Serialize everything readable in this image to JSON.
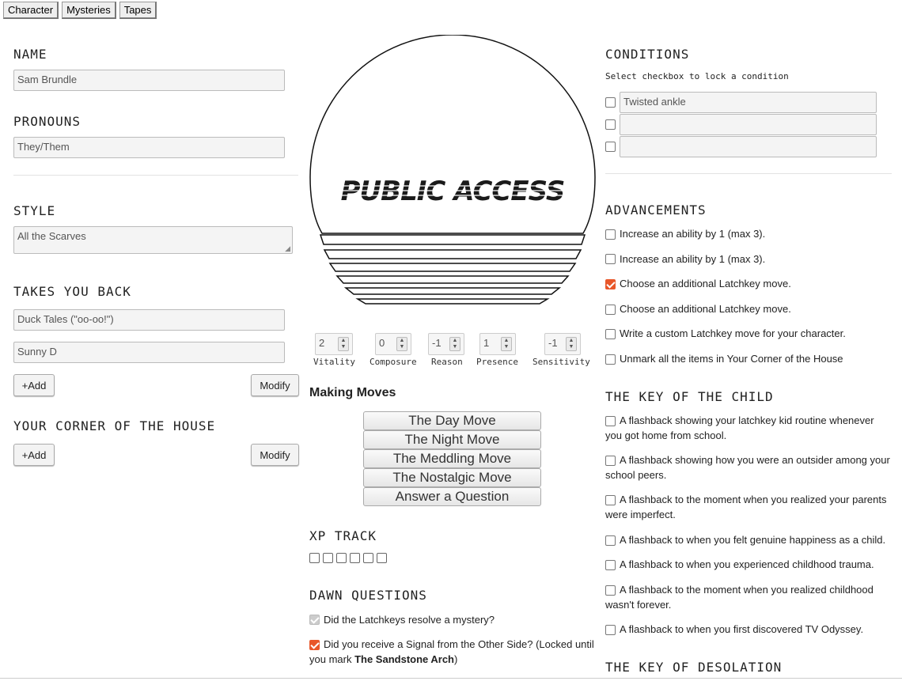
{
  "tabs": [
    "Character",
    "Mysteries",
    "Tapes"
  ],
  "left": {
    "name_label": "NAME",
    "name_value": "Sam Brundle",
    "pronouns_label": "PRONOUNS",
    "pronouns_value": "They/Them",
    "style_label": "STYLE",
    "style_value": "All the Scarves",
    "takes_back_label": "TAKES YOU BACK",
    "takes_back_items": [
      "Duck Tales (\"oo-oo!\")",
      "Sunny D"
    ],
    "add_label": "+Add",
    "modify_label": "Modify",
    "corner_label": "YOUR CORNER OF THE HOUSE"
  },
  "center": {
    "logo_text": "PUBLIC ACCESS",
    "stats": [
      {
        "label": "Vitality",
        "value": "2"
      },
      {
        "label": "Composure",
        "value": "0"
      },
      {
        "label": "Reason",
        "value": "-1"
      },
      {
        "label": "Presence",
        "value": "1"
      },
      {
        "label": "Sensitivity",
        "value": "-1"
      }
    ],
    "making_moves_label": "Making Moves",
    "moves": [
      "The Day Move",
      "The Night Move",
      "The Meddling Move",
      "The Nostalgic Move",
      "Answer a Question"
    ],
    "xp_label": "XP TRACK",
    "xp_boxes": 6,
    "xp_marked": 0,
    "dawn_label": "DAWN QUESTIONS",
    "dawn_q1": "Did the Latchkeys resolve a mystery?",
    "dawn_q2_prefix": "Did you receive a Signal from the Other Side? (Locked until you mark ",
    "dawn_q2_bold": "The Sandstone Arch",
    "dawn_q2_suffix": ")"
  },
  "right": {
    "conditions_label": "CONDITIONS",
    "conditions_hint": "Select checkbox to lock a condition",
    "conditions": [
      "Twisted ankle",
      "",
      ""
    ],
    "advancements_label": "ADVANCEMENTS",
    "advancements": [
      {
        "text": "Increase an ability by 1 (max 3).",
        "checked": false
      },
      {
        "text": "Increase an ability by 1 (max 3).",
        "checked": false
      },
      {
        "text": "Choose an additional Latchkey move.",
        "checked": true
      },
      {
        "text": "Choose an additional Latchkey move.",
        "checked": false
      },
      {
        "text": "Write a custom Latchkey move for your character.",
        "checked": false
      },
      {
        "text": "Unmark all the items in Your Corner of the House",
        "checked": false
      }
    ],
    "key_child_label": "THE KEY OF THE CHILD",
    "key_child_items": [
      "A flashback showing your latchkey kid routine whenever you got home from school.",
      "A flashback showing how you were an outsider among your school peers.",
      "A flashback to the moment when you realized your parents were imperfect.",
      "A flashback to when you felt genuine happiness as a child.",
      "A flashback to when you experienced childhood trauma.",
      "A flashback to the moment when you realized childhood wasn't forever.",
      "A flashback to when you first discovered TV Odyssey."
    ],
    "key_desolation_label": "THE KEY OF DESOLATION"
  },
  "colors": {
    "accent": "#e8572a",
    "input_bg": "#f4f4f4"
  }
}
